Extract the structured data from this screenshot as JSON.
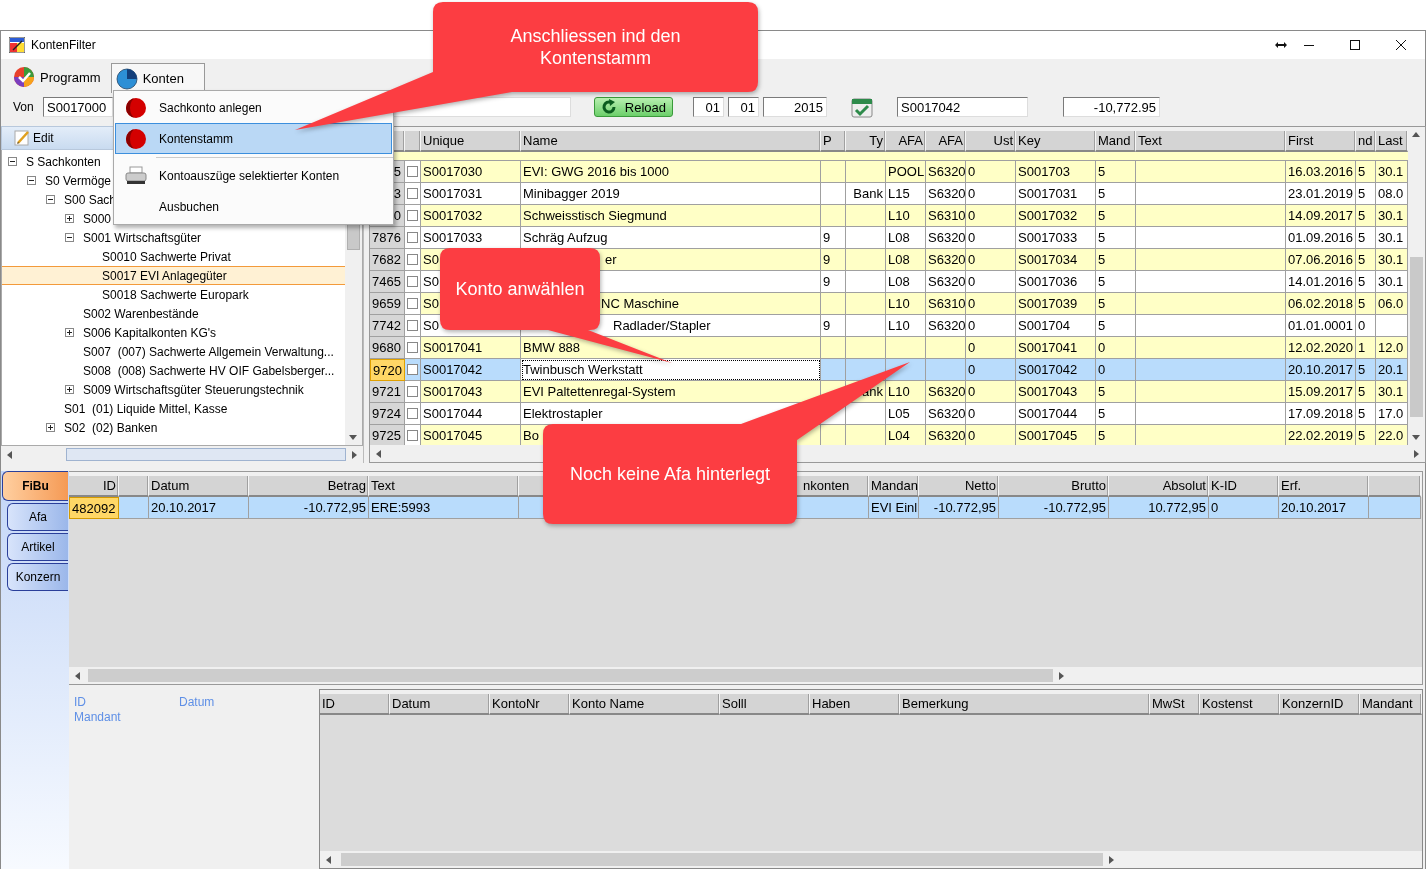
{
  "window": {
    "title": "KontenFilter"
  },
  "menu_bar": [
    {
      "label": "Programm",
      "selected": false
    },
    {
      "label": "Konten",
      "selected": true
    }
  ],
  "konten_menu": [
    {
      "kind": "record",
      "label": "Sachkonto anlegen",
      "selected": false
    },
    {
      "kind": "record",
      "label": "Kontenstamm",
      "selected": true
    },
    {
      "kind": "separator"
    },
    {
      "kind": "print",
      "label": "Kontoauszüge selektierter Konten",
      "selected": false
    },
    {
      "kind": "plain",
      "label": "Ausbuchen",
      "selected": false
    }
  ],
  "toolbar": {
    "von_label": "Von",
    "von_value": "S0017000",
    "reload": "Reload",
    "day": "01",
    "month": "01",
    "year": "2015",
    "account": "S0017042",
    "amount": "-10,772.95"
  },
  "tree_toolbar": {
    "edit": "Edit"
  },
  "tree": [
    {
      "label": "S Sachkonten",
      "expanded": true,
      "selected": false,
      "children": [
        {
          "label": "S0 Vermöge",
          "expanded": true,
          "selected": false,
          "children": [
            {
              "label": "S00 Sach",
              "expanded": true,
              "selected": false,
              "children": [
                {
                  "label": "S000",
                  "expanded": false,
                  "selected": false
                },
                {
                  "label": "S001 Wirtschaftsgüter",
                  "expanded": true,
                  "selected": false,
                  "children": [
                    {
                      "label": "S0010 Sachwerte Privat",
                      "selected": false
                    },
                    {
                      "label": "S0017 EVI Anlagegüter",
                      "selected": true
                    },
                    {
                      "label": "S0018 Sachwerte Europark",
                      "selected": false
                    }
                  ]
                },
                {
                  "label": "S002 Warenbestände",
                  "selected": false
                },
                {
                  "label": "S006 Kapitalkonten KG's",
                  "expanded": false,
                  "selected": false
                },
                {
                  "label": "S007  (007) Sachwerte Allgemein Verwaltung...",
                  "selected": false
                },
                {
                  "label": "S008  (008) Sachwerte HV OIF Gabelsberger...",
                  "selected": false
                },
                {
                  "label": "S009 Wirtschaftsgüter Steuerungstechnik",
                  "expanded": false,
                  "selected": false
                }
              ]
            },
            {
              "label": "S01  (01) Liquide Mittel, Kasse",
              "selected": false
            },
            {
              "label": "S02  (02) Banken",
              "expanded": false,
              "selected": false
            }
          ]
        }
      ]
    }
  ],
  "accounts_table": {
    "columns": [
      "Unique",
      "Name",
      "P",
      "Ty",
      "AFA",
      "AFA",
      "Ust",
      "Key",
      "Mand",
      "Text",
      "First",
      "nd",
      "Last"
    ],
    "rows": [
      {
        "number": "5",
        "checked": false,
        "selected": false,
        "cells": [
          "S0017030",
          "EVI: GWG 2016 bis 1000",
          null,
          null,
          "POOL",
          "S6320",
          "0",
          "S001703",
          "5",
          null,
          "16.03.2016",
          "5",
          "30.1"
        ]
      },
      {
        "number": "3",
        "checked": false,
        "selected": false,
        "cells": [
          "S0017031",
          "Minibagger 2019",
          null,
          "Bank",
          "L15",
          "S6320",
          "0",
          "S0017031",
          "5",
          null,
          "23.01.2019",
          "5",
          "08.0"
        ]
      },
      {
        "number": "0",
        "checked": false,
        "selected": false,
        "cells": [
          "S0017032",
          "Schweisstisch Siegmund",
          null,
          null,
          "L10",
          "S6310",
          "0",
          "S0017032",
          "5",
          null,
          "14.09.2017",
          "5",
          "30.1"
        ]
      },
      {
        "number": "7876",
        "checked": false,
        "selected": false,
        "cells": [
          "S0017033",
          "Schräg Aufzug",
          "9",
          null,
          "L08",
          "S6320",
          "0",
          "S0017033",
          "5",
          null,
          "01.09.2016",
          "5",
          "30.1"
        ]
      },
      {
        "number": "7682",
        "checked": false,
        "selected": false,
        "cells": [
          "S0",
          "er",
          "9",
          null,
          "L08",
          "S6320",
          "0",
          "S0017034",
          "5",
          null,
          "07.06.2016",
          "5",
          "30.1"
        ]
      },
      {
        "number": "7465",
        "checked": false,
        "selected": false,
        "cells": [
          "S0",
          null,
          "9",
          null,
          "L08",
          "S6320",
          "0",
          "S0017036",
          "5",
          null,
          "14.01.2016",
          "5",
          "30.1"
        ]
      },
      {
        "number": "9659",
        "checked": false,
        "selected": false,
        "cells": [
          "S0",
          "NC Maschine",
          null,
          null,
          "L10",
          "S6310",
          "0",
          "S0017039",
          "5",
          null,
          "06.02.2018",
          "5",
          "06.0"
        ]
      },
      {
        "number": "7742",
        "checked": false,
        "selected": false,
        "cells": [
          "S0",
          "Radlader/Stapler",
          "9",
          null,
          "L10",
          "S6320",
          "0",
          "S001704",
          "5",
          null,
          "01.01.0001",
          "0",
          null
        ]
      },
      {
        "number": "9680",
        "checked": false,
        "selected": false,
        "cells": [
          "S0017041",
          "BMW 888",
          null,
          null,
          null,
          null,
          "0",
          "S0017041",
          "0",
          null,
          "12.02.2020",
          "1",
          "12.0"
        ]
      },
      {
        "number": "9720",
        "checked": false,
        "selected": true,
        "cells": [
          "S0017042",
          "Twinbusch Werkstatt",
          null,
          null,
          null,
          null,
          "0",
          "S0017042",
          "0",
          null,
          "20.10.2017",
          "5",
          "20.1"
        ]
      },
      {
        "number": "9721",
        "checked": false,
        "selected": false,
        "cells": [
          "S0017043",
          "EVI Paltettenregal-System",
          null,
          "ank",
          "L10",
          "S6320",
          "0",
          "S0017043",
          "5",
          null,
          "15.09.2017",
          "5",
          "30.1"
        ]
      },
      {
        "number": "9724",
        "checked": false,
        "selected": false,
        "cells": [
          "S0017044",
          "Elektrostapler",
          null,
          null,
          "L05",
          "S6320",
          "0",
          "S0017044",
          "5",
          null,
          "17.09.2018",
          "5",
          "17.0"
        ]
      },
      {
        "number": "9725",
        "checked": false,
        "selected": false,
        "cells": [
          "S0017045",
          "Bo",
          null,
          null,
          "L04",
          "S6320",
          "0",
          "S0017045",
          "5",
          null,
          "22.02.2019",
          "5",
          "22.0"
        ]
      }
    ]
  },
  "booking_tabs": [
    {
      "label": "FiBu",
      "selected": true
    },
    {
      "label": "Afa",
      "selected": false
    },
    {
      "label": "Artikel",
      "selected": false
    },
    {
      "label": "Konzern",
      "selected": false
    }
  ],
  "bookings_table": {
    "columns": [
      "ID",
      null,
      "Datum",
      "Betrag",
      "Text",
      null,
      "nkonten",
      "Mandan",
      "Netto",
      "Brutto",
      "Absolut",
      "K-ID",
      "Erf.",
      null
    ],
    "rows": [
      {
        "selected": true,
        "cells": [
          "482092",
          null,
          "20.10.2017",
          "-10.772,95",
          "ERE:5993",
          null,
          null,
          "EVI Einl",
          "-10.772,95",
          "-10.772,95",
          "10.772,95",
          "0",
          "20.10.2017",
          null
        ]
      }
    ]
  },
  "detail_labels": {
    "id": "ID",
    "datum": "Datum",
    "mandant": "Mandant"
  },
  "detail_table": {
    "columns": [
      "ID",
      "Datum",
      "KontoNr",
      "Konto Name",
      "Solll",
      "Haben",
      "Bemerkung",
      "MwSt",
      "Kostenst",
      "KonzernID",
      "Mandant"
    ]
  },
  "callouts": [
    {
      "text": "Anschliessen ind den Kontenstamm"
    },
    {
      "text": "Konto anwählen"
    },
    {
      "text": "Noch keine Afa hinterlegt"
    }
  ]
}
